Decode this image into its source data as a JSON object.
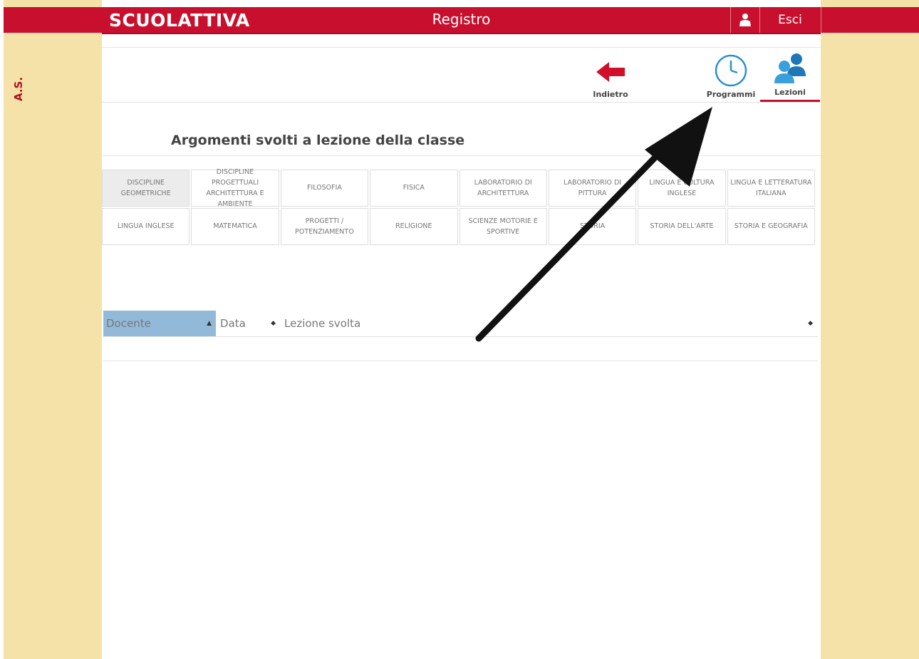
{
  "header": {
    "logo": "SCUOLATTIVA",
    "title": "Registro",
    "logout_label": "Esci",
    "user_icon": "user-icon"
  },
  "sidebar": {
    "year_label": "A.S."
  },
  "toolbar": {
    "back_label": "Indietro",
    "programs_label": "Programmi",
    "lessons_label": "Lezioni",
    "back_icon": "arrow-left-icon",
    "programs_icon": "clock-icon",
    "lessons_icon": "users-icon"
  },
  "page": {
    "title": "Argomenti svolti a lezione della classe"
  },
  "subjects": [
    "DISCIPLINE GEOMETRICHE",
    "DISCIPLINE PROGETTUALI ARCHITETTURA E AMBIENTE",
    "FILOSOFIA",
    "FISICA",
    "LABORATORIO DI ARCHITETTURA",
    "LABORATORIO DI PITTURA",
    "LINGUA E CULTURA INGLESE",
    "LINGUA E LETTERATURA ITALIANA",
    "LINGUA INGLESE",
    "MATEMATICA",
    "PROGETTI / POTENZIAMENTO",
    "RELIGIONE",
    "SCIENZE MOTORIE E SPORTIVE",
    "STORIA",
    "STORIA DELL'ARTE",
    "STORIA E GEOGRAFIA"
  ],
  "table": {
    "columns": [
      "Docente",
      "Data",
      "Lezione svolta"
    ],
    "sort_asc": "▲",
    "sort_both": "◆"
  },
  "colors": {
    "brand_red": "#c8102e",
    "side_panel": "#f5e2a8",
    "active_header": "#93b9d8"
  }
}
